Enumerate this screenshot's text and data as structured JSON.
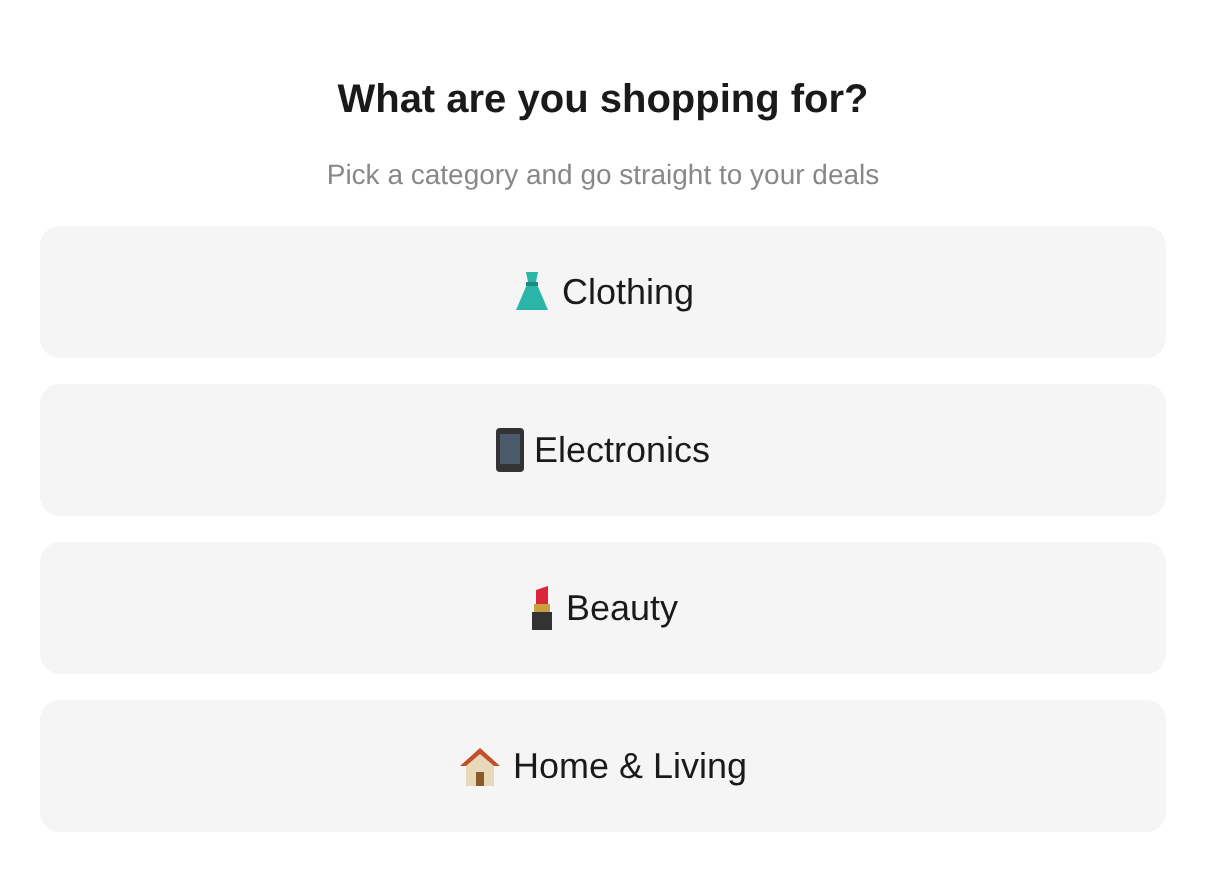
{
  "title": "What are you shopping for?",
  "subtitle": "Pick a category and go straight to your deals",
  "categories": [
    {
      "kind": "dress",
      "label": "Clothing"
    },
    {
      "kind": "phone",
      "label": "Electronics"
    },
    {
      "kind": "lipstick",
      "label": "Beauty"
    },
    {
      "kind": "house",
      "label": "Home & Living"
    }
  ]
}
